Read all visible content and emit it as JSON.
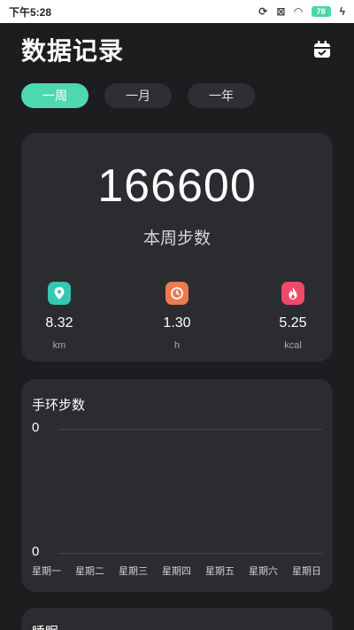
{
  "status_bar": {
    "time": "下午5:28",
    "battery": "78"
  },
  "header": {
    "title": "数据记录",
    "calendar_icon": "calendar-icon"
  },
  "tabs": [
    {
      "label": "一周",
      "active": true
    },
    {
      "label": "一月",
      "active": false
    },
    {
      "label": "一年",
      "active": false
    }
  ],
  "summary": {
    "steps": "166600",
    "steps_label": "本周步数",
    "stats": [
      {
        "value": "8.32",
        "unit": "km",
        "icon": "location-pin-icon",
        "color": "#35c6b4"
      },
      {
        "value": "1.30",
        "unit": "h",
        "icon": "clock-icon",
        "color": "#ee7a4e"
      },
      {
        "value": "5.25",
        "unit": "kcal",
        "icon": "flame-icon",
        "color": "#ef4a6b"
      }
    ]
  },
  "band_chart": {
    "title": "手环步数",
    "y_top_label": "0",
    "y_bottom_label": "0",
    "days": [
      "星期一",
      "星期二",
      "星期三",
      "星期四",
      "星期五",
      "星期六",
      "星期日"
    ]
  },
  "next_section": {
    "title": "睡眠"
  },
  "colors": {
    "accent": "#4dd9ad",
    "background": "#1c1d1f",
    "card": "#2b2c30"
  }
}
